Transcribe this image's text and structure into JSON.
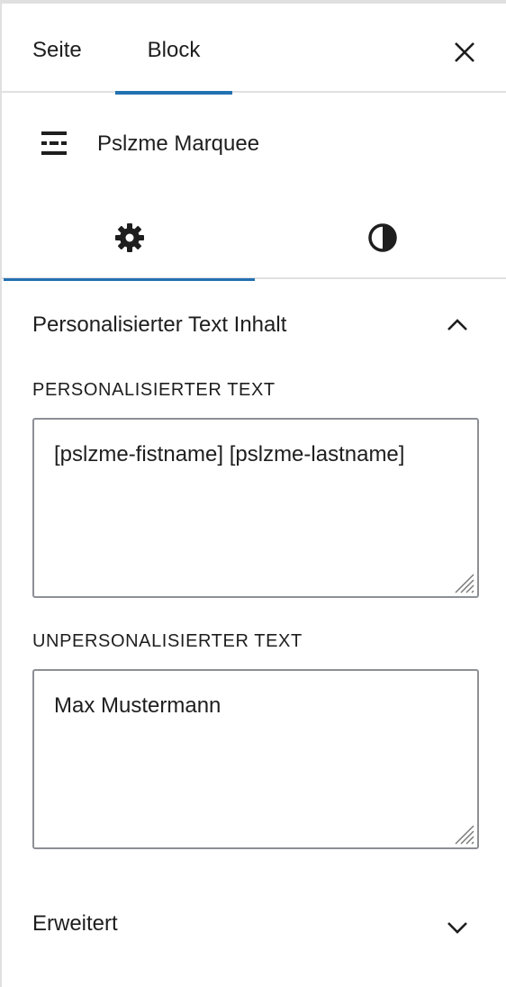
{
  "top_tabs": {
    "seite": "Seite",
    "block": "Block",
    "active": "block"
  },
  "block": {
    "title": "Pslzme Marquee",
    "icon": "marquee-icon"
  },
  "sub_tabs": {
    "settings_icon": "gear-icon",
    "styles_icon": "contrast-icon",
    "active": "settings"
  },
  "panel": {
    "title": "Personalisierter Text Inhalt",
    "expanded": true,
    "personalized": {
      "label": "Personalisierter Text",
      "value": "[pslzme-fistname] [pslzme-lastname]"
    },
    "unpersonalized": {
      "label": "Unpersonalisierter Text",
      "value": "Max Mustermann"
    }
  },
  "advanced": {
    "title": "Erweitert",
    "expanded": false
  },
  "colors": {
    "accent": "#2271b1",
    "text": "#1e1e1e",
    "border": "#8c8f94",
    "divider": "#e0e0e0"
  }
}
